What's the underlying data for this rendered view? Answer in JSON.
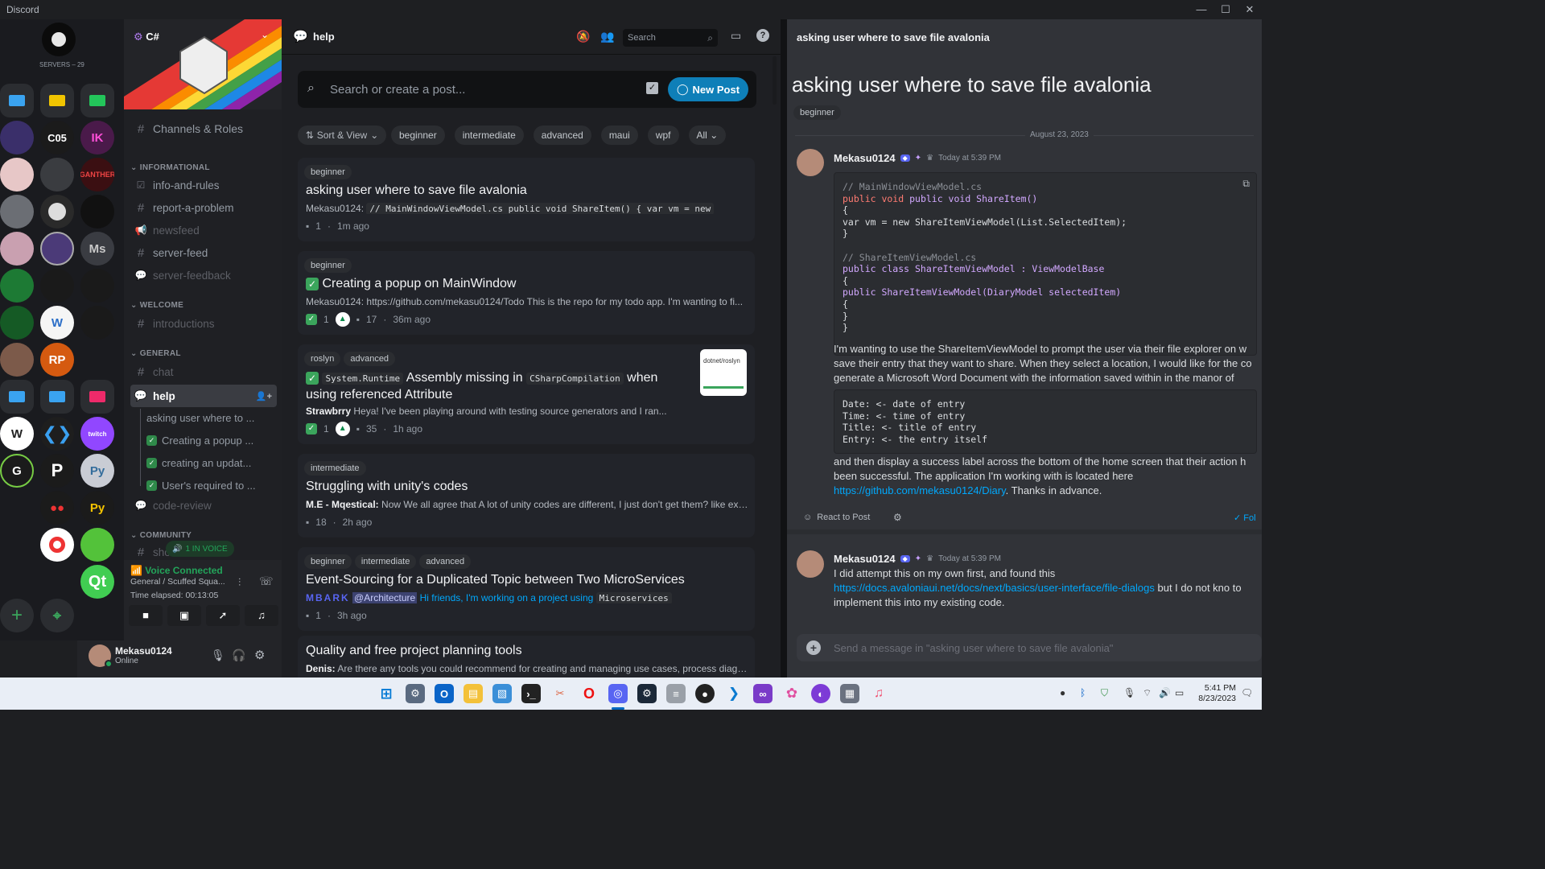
{
  "window": {
    "title": "Discord"
  },
  "rail": {
    "servers_label": "SERVERS – 29",
    "ms_label": "Ms",
    "mo_label": "C05"
  },
  "server": {
    "name": "C#",
    "channels_roles": "Channels & Roles",
    "categories": {
      "informational": "INFORMATIONAL",
      "welcome": "WELCOME",
      "general": "GENERAL",
      "community": "COMMUNITY"
    },
    "channels": {
      "info_and_rules": "info-and-rules",
      "report_a_problem": "report-a-problem",
      "newsfeed": "newsfeed",
      "server_feed": "server-feed",
      "server_feedback": "server-feedback",
      "introductions": "introductions",
      "chat": "chat",
      "help": "help",
      "code_review": "code-review",
      "show": "show"
    },
    "threads": [
      "asking user where to ...",
      "Creating a popup ...",
      "creating an updat...",
      "User's required to ..."
    ]
  },
  "voice": {
    "in_voice": "1 IN VOICE",
    "status": "Voice Connected",
    "channel": "General / Scuffed Squa...",
    "elapsed": "Time elapsed: 00:13:05"
  },
  "user": {
    "name": "Mekasu0124",
    "status": "Online"
  },
  "forum": {
    "channel_name": "help",
    "search_placeholder": "Search",
    "post_search_placeholder": "Search or create a post...",
    "new_post": "New Post",
    "sort_view": "Sort & View",
    "filter_tags": [
      "beginner",
      "intermediate",
      "advanced",
      "maui",
      "wpf",
      "All"
    ],
    "posts": [
      {
        "tags": [
          "beginner"
        ],
        "title": "asking user where to save file avalonia",
        "author": "Mekasu0124:",
        "preview": "// MainWindowViewModel.cs public void ShareItem() {   var vm = new",
        "count": "1",
        "time": "1m ago"
      },
      {
        "tags": [
          "beginner"
        ],
        "title": "Creating a popup on MainWindow",
        "author": "Mekasu0124:",
        "preview": "https://github.com/mekasu0124/Todo This is the repo for my todo app. I'm wanting to fi...",
        "reactions": "1",
        "count": "17",
        "time": "36m ago"
      },
      {
        "tags": [
          "roslyn",
          "advanced"
        ],
        "title_code1": "System.Runtime",
        "title_mid": "Assembly missing in",
        "title_code2": "CSharpCompilation",
        "title_end": "when",
        "title_line2": "using referenced Attribute",
        "author": "Strawbrry",
        "preview": "Heya!  I've been playing around with testing source generators and I ran...",
        "reactions": "1",
        "count": "35",
        "time": "1h ago",
        "thumb_label": "dotnet/roslyn"
      },
      {
        "tags": [
          "intermediate"
        ],
        "title": "Struggling with unity's codes",
        "author": "M.E - Mqestical:",
        "preview": "Now We all agree that A lot of unity codes are different, I just don't get them? like excl...",
        "count": "18",
        "time": "2h ago"
      },
      {
        "tags": [
          "beginner",
          "intermediate",
          "advanced"
        ],
        "title": "Event-Sourcing for a Duplicated Topic between Two MicroServices",
        "author": "MBARK",
        "mention": "@Architecture",
        "preview": "Hi friends, I'm working on a project using",
        "preview_code": "Microservices",
        "count": "1",
        "time": "3h ago"
      },
      {
        "title": "Quality and free project planning tools",
        "author": "Denis:",
        "preview": "Are there any tools you could recommend for creating and managing use cases, process diagra..."
      }
    ]
  },
  "thread": {
    "header": "asking user where to save file avalonia",
    "title": "asking user where to save file avalonia",
    "tag": "beginner",
    "date": "August 23, 2023",
    "author": "Mekasu0124",
    "timestamp": "Today at 5:39 PM",
    "code_lines": [
      "// MainWindowViewModel.cs",
      "public void ShareItem()",
      "{",
      "  var vm = new ShareItemViewModel(List.SelectedItem);",
      "}",
      "",
      "// ShareItemViewModel.cs",
      "public class ShareItemViewModel : ViewModelBase",
      "{",
      "  public ShareItemViewModel(DiaryModel selectedItem)",
      "  {",
      "  }",
      "}"
    ],
    "body1": "I'm wanting to use the ShareItemViewModel to prompt the user via their file explorer on w save their entry that they want to share. When they select a location, I would like for the co generate a Microsoft Word Document with the information saved within in the manor of",
    "code2_lines": [
      "Date: <- date of entry",
      "Time: <- time of entry",
      "Title: <- title of entry",
      "Entry: <- the entry itself"
    ],
    "body2": "and then display a success label across the bottom of the home screen that their action h been successful. The application I'm working with is located here",
    "repo_link": "https://github.com/mekasu0124/Diary",
    "body2_end": ". Thanks in advance.",
    "react": "React to Post",
    "follow": "Fol",
    "reply_author": "Mekasu0124",
    "reply_time": "Today at 5:39 PM",
    "reply_body1": "I did attempt this on my own first, and found this",
    "reply_link": "https://docs.avaloniaui.net/docs/next/basics/user-interface/file-dialogs",
    "reply_body2": " but I do not kno to implement this into my existing code.",
    "composer_placeholder": "Send a message in \"asking user where to save file avalonia\""
  },
  "taskbar": {
    "time": "5:41 PM",
    "date": "8/23/2023"
  },
  "colors": {
    "accent": "#5865f2",
    "new_post": "#0e7fb8",
    "green": "#23a55a",
    "link": "#00a8fc"
  }
}
